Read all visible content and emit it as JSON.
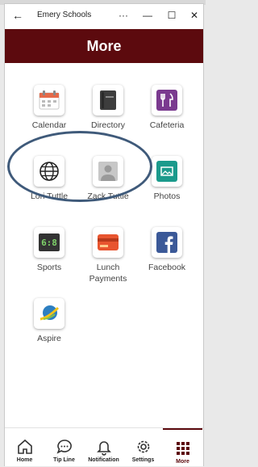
{
  "window": {
    "title": "Emery Schools",
    "back_icon": "←",
    "more_icon": "···",
    "minimize_icon": "—",
    "maximize_icon": "☐",
    "close_icon": "✕"
  },
  "header": {
    "title": "More"
  },
  "grid": [
    {
      "label": "Calendar",
      "icon": "calendar-icon"
    },
    {
      "label": "Directory",
      "icon": "directory-icon"
    },
    {
      "label": "Cafeteria",
      "icon": "cafeteria-icon"
    },
    {
      "label": "Lori Tuttle",
      "icon": "globe-icon"
    },
    {
      "label": "Zack Tuttle",
      "icon": "person-icon"
    },
    {
      "label": "Photos",
      "icon": "photos-icon"
    },
    {
      "label": "Sports",
      "icon": "scoreboard-icon"
    },
    {
      "label": "Lunch\nPayments",
      "icon": "credit-card-icon"
    },
    {
      "label": "Facebook",
      "icon": "facebook-icon"
    },
    {
      "label": "Aspire",
      "icon": "aspire-icon"
    }
  ],
  "tabs": [
    {
      "label": "Home",
      "icon": "home-icon"
    },
    {
      "label": "Tip Line",
      "icon": "chat-icon"
    },
    {
      "label": "Notification",
      "icon": "bell-icon"
    },
    {
      "label": "Settings",
      "icon": "gear-icon"
    },
    {
      "label": "More",
      "icon": "grid-icon",
      "active": true
    }
  ],
  "colors": {
    "brand": "#5c0a0e",
    "circle": "#3f5a7a"
  }
}
